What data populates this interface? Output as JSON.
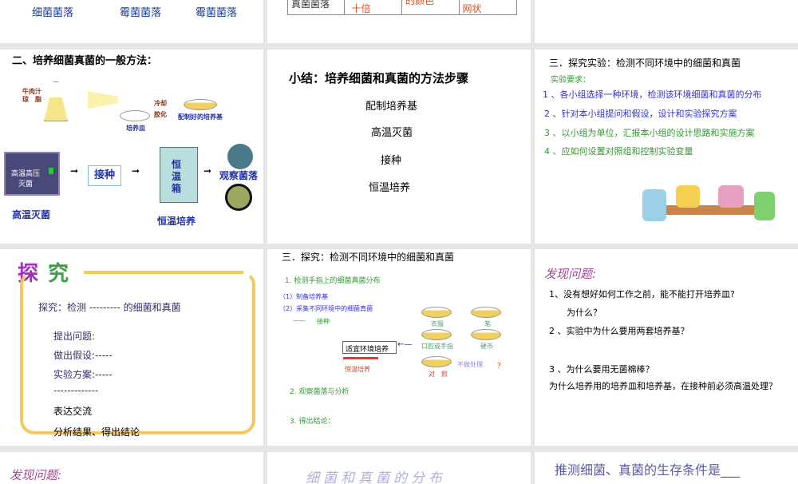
{
  "slide_r0a": {
    "labels": [
      "细菌菌落",
      "霉菌菌落",
      "霉菌菌落"
    ]
  },
  "slide_r0b": {
    "row_header": "真菌菌落",
    "cells": [
      "十倍",
      "的颜色",
      "网状"
    ]
  },
  "slide_method": {
    "title": "二、培养细菌真菌的一般方法：",
    "beef": "牛肉汁",
    "agar": "琼　脂",
    "dish": "培养皿",
    "cool": "冷却",
    "gel": "胶化",
    "medium": "配制好的培养基",
    "autoclave": "高温高压灭菌",
    "sterilize": "高温灭菌",
    "inoculate": "接种",
    "incubator": "恒温箱",
    "incubate": "恒温培养",
    "observe": "观察菌落"
  },
  "slide_summary": {
    "title": "小结：培养细菌和真菌的方法步骤",
    "steps": [
      "配制培养基",
      "高温灭菌",
      "接种",
      "恒温培养"
    ]
  },
  "slide_experiment": {
    "title": "三．探究实验：检测不同环境中的细菌和真菌",
    "subtitle": "实验要求：",
    "items": [
      "1 、各小组选择一种环境，检测该环境细菌和真菌的分布",
      "2 、针对本小组提问和假设，设计和实验探究方案",
      "3 、以小组为单位，汇报本小组的设计思路和实施方案",
      "4 、应如何设置对照组和控制实验变量"
    ],
    "colors": {
      "blue": "#3333cc",
      "green": "#339933"
    }
  },
  "slide_inquiry": {
    "title1": "探",
    "title2": "究",
    "line1": "探究：检测 --------- 的细菌和真菌",
    "steps": [
      "提出问题:",
      "做出假设:-----",
      "实验方案:-----",
      "-------------",
      "表达交流",
      "分析结果、得出结论"
    ]
  },
  "slide_explore": {
    "title": "三．探究：检测不同环境中的细菌和真菌",
    "s1": "1.  检测手指上的细菌真菌分布",
    "p1": "（1）制备培养基",
    "p2": "（2）采集不同环境中的细菌真菌",
    "dash": "——",
    "inoc": "接种",
    "box": "适宜环境培养",
    "incub": "恒温培养",
    "d1": "衣服",
    "d2": "笔",
    "d3": "口腔或手指",
    "d4": "硬币",
    "d5": "对　照",
    "none": "不做处理",
    "q": "？",
    "s2": "2.  观察菌落与分析",
    "s3": "3. 得出结论："
  },
  "slide_questions": {
    "title": "发现问题:",
    "q1": "1、没有想好如何工作之前，能不能打开培养皿?",
    "q1b": "为什么？",
    "q2": "2 、实验中为什么要用两套培养基？",
    "q3": "3 、为什么要用无菌棉棒？",
    "q4": "为什么培养用的培养皿和培养基，在接种前必须高温处理？"
  },
  "slide_r3": {
    "a": "发现问题:",
    "b": "细菌和真菌的分布",
    "c": "推测细菌、真菌的生存条件是___"
  }
}
